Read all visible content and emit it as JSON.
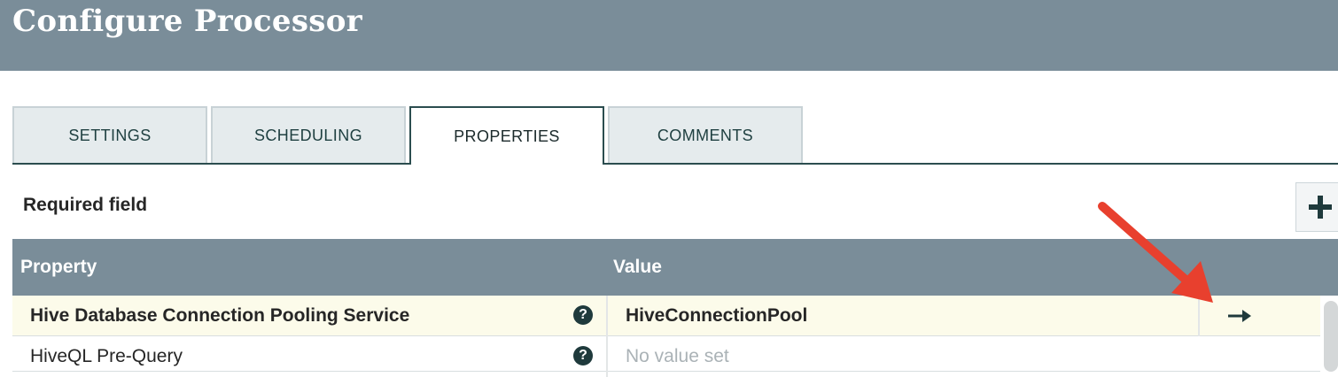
{
  "dialog": {
    "title": "Configure Processor"
  },
  "tabs": [
    {
      "label": "SETTINGS"
    },
    {
      "label": "SCHEDULING"
    },
    {
      "label": "PROPERTIES"
    },
    {
      "label": "COMMENTS"
    }
  ],
  "active_tab": "PROPERTIES",
  "required_label": "Required field",
  "grid": {
    "columns": [
      "Property",
      "Value"
    ],
    "rows": [
      {
        "property": "Hive Database Connection Pooling Service",
        "value": "HiveConnectionPool",
        "required": true,
        "selected": true
      },
      {
        "property": "HiveQL Pre-Query",
        "value": "No value set",
        "required": false,
        "selected": false
      }
    ]
  },
  "colors": {
    "header_bg": "#7a8d99",
    "tab_text": "#1e3f40",
    "selected_row": "#fcfbea",
    "annotation_arrow": "#e8402e"
  },
  "icons": [
    "plus-icon",
    "help-icon",
    "arrow-right-icon"
  ]
}
